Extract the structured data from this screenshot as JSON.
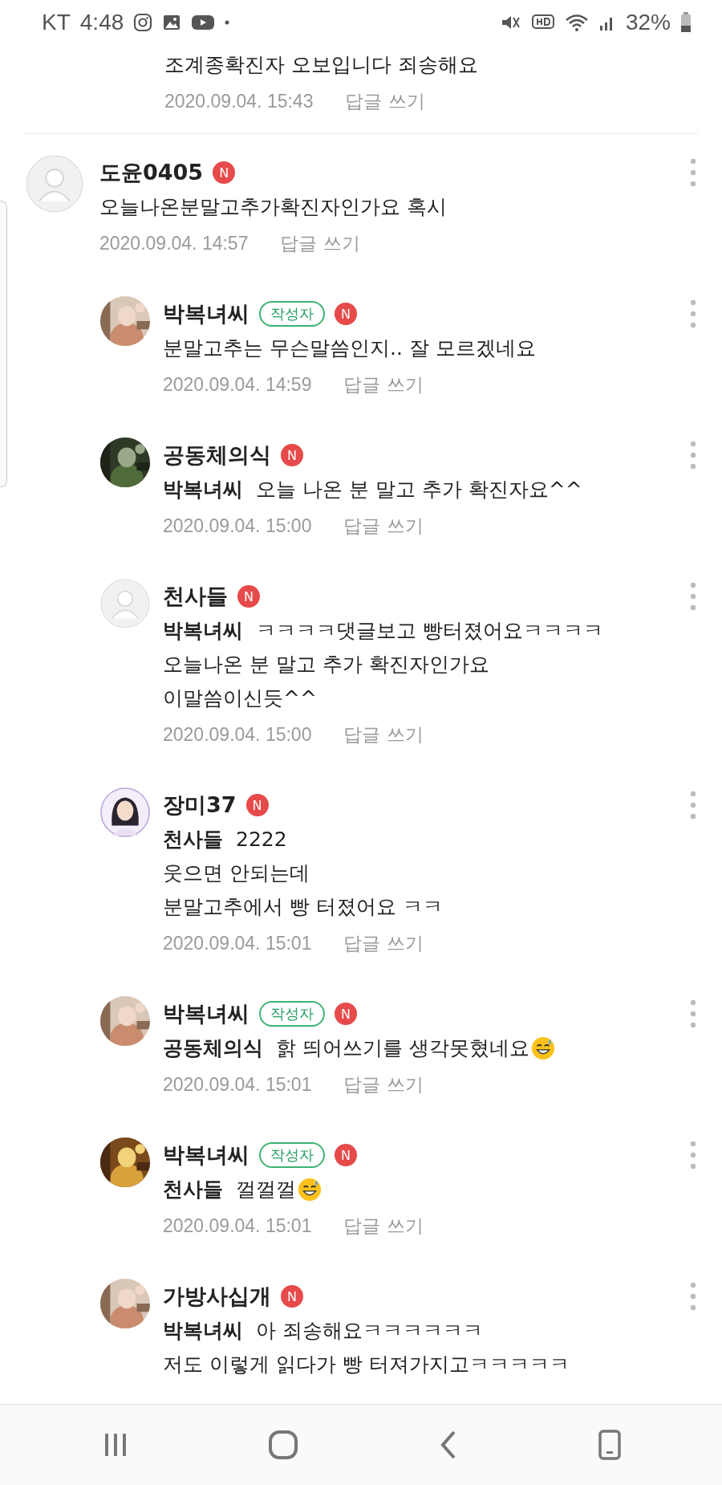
{
  "status_bar": {
    "carrier": "KT",
    "time": "4:48",
    "battery": "32%"
  },
  "previous_comment": {
    "text": "조계종확진자 오보입니다 죄송해요",
    "date": "2020.09.04. 15:43",
    "reply_label": "답글 쓰기"
  },
  "comment": {
    "avatar": {
      "kind": "default"
    },
    "name": "도윤0405",
    "new_badge": "N",
    "lines": [
      "오늘나온분말고추가확진자인가요 혹시"
    ],
    "date": "2020.09.04. 14:57",
    "reply_label": "답글 쓰기",
    "children": [
      {
        "avatar": {
          "kind": "picture"
        },
        "name": "박복녀씨",
        "author_badge": "작성자",
        "new_badge": "N",
        "lines": [
          "분말고추는 무슨말씀인지.. 잘 모르겠네요"
        ],
        "date": "2020.09.04. 14:59",
        "reply_label": "답글 쓰기"
      },
      {
        "avatar": {
          "kind": "picture"
        },
        "name": "공동체의식",
        "new_badge": "N",
        "mention": "박복녀씨",
        "lines": [
          "오늘 나온 분 말고 추가 확진자요^^"
        ],
        "date": "2020.09.04. 15:00",
        "reply_label": "답글 쓰기"
      },
      {
        "avatar": {
          "kind": "default"
        },
        "name": "천사들",
        "new_badge": "N",
        "mention": "박복녀씨",
        "lines": [
          "ㅋㅋㅋㅋ댓글보고 빵터졌어요ㅋㅋㅋㅋ",
          "오늘나온 분 말고 추가 확진자인가요",
          "이말씀이신듯^^"
        ],
        "date": "2020.09.04. 15:00",
        "reply_label": "답글 쓰기"
      },
      {
        "avatar": {
          "kind": "illustration"
        },
        "name": "장미37",
        "new_badge": "N",
        "mention": "천사들",
        "lines": [
          "2222",
          "웃으면 안되는데",
          "분말고추에서 빵 터졌어요 ㅋㅋ"
        ],
        "date": "2020.09.04. 15:01",
        "reply_label": "답글 쓰기"
      },
      {
        "avatar": {
          "kind": "picture"
        },
        "name": "박복녀씨",
        "author_badge": "작성자",
        "new_badge": "N",
        "mention": "공동체의식",
        "lines": [
          "핡 띄어쓰기를 생각못혔네요"
        ],
        "emoji": true,
        "date": "2020.09.04. 15:01",
        "reply_label": "답글 쓰기"
      },
      {
        "avatar": {
          "kind": "picture"
        },
        "name": "박복녀씨",
        "author_badge": "작성자",
        "new_badge": "N",
        "mention": "천사들",
        "lines": [
          "껄껄껄"
        ],
        "emoji": true,
        "date": "2020.09.04. 15:01",
        "reply_label": "답글 쓰기"
      },
      {
        "avatar": {
          "kind": "picture"
        },
        "name": "가방사십개",
        "new_badge": "N",
        "mention": "박복녀씨",
        "lines": [
          "아 죄송해요ㅋㅋㅋㅋㅋㅋ",
          "저도 이렇게 읽다가 빵 터져가지고ㅋㅋㅋㅋㅋ"
        ]
      }
    ]
  }
}
